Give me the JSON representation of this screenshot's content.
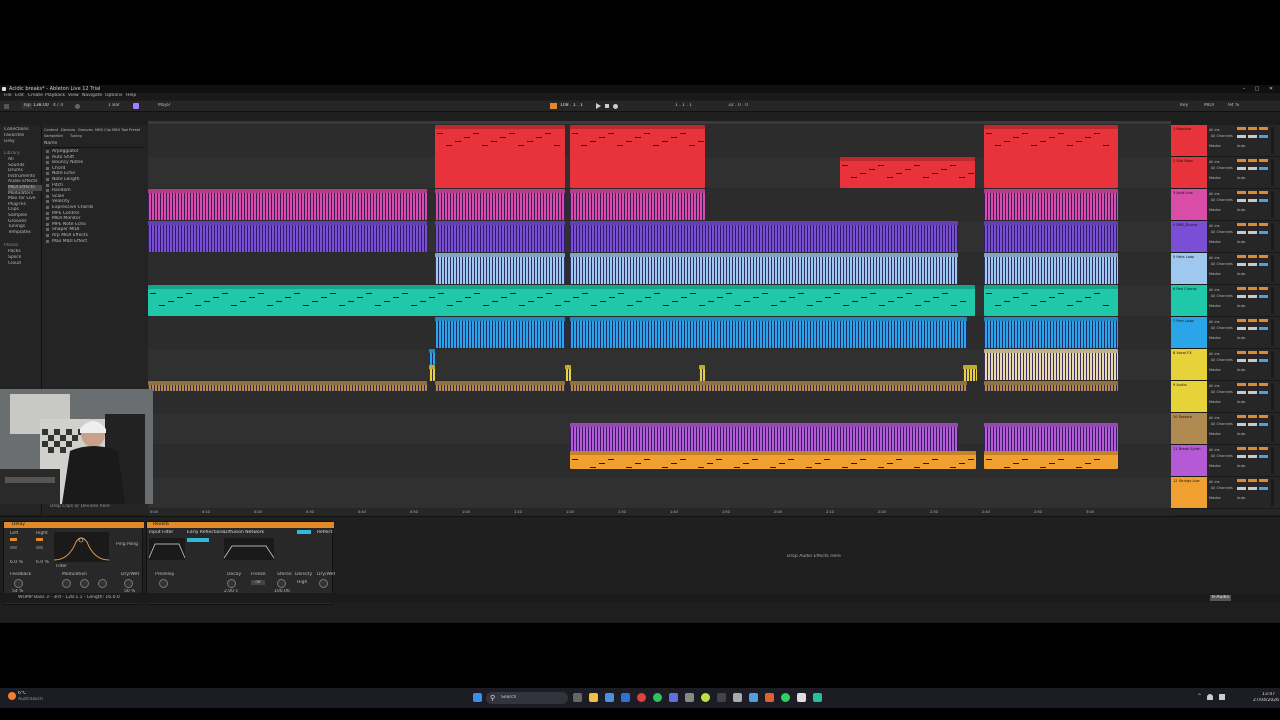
{
  "window": {
    "title": "Acidic breaks* - Ableton Live 12 Trial"
  },
  "menu": [
    "File",
    "Edit",
    "Create",
    "Playback",
    "View",
    "Navigate",
    "Options",
    "Help"
  ],
  "toolbar": {
    "tap": "Tap",
    "tempo": "138.00",
    "sig": "4 / 4",
    "metro": "1 Bar",
    "key": "Major",
    "pos": "108 . 1 . 1",
    "loop_start": "1 . 1 . 1",
    "loop_len": "32 . 0 . 0",
    "cpu": "94 %",
    "key_label": "Key",
    "midi_label": "MIDI"
  },
  "browser": {
    "tabs": [
      "Content",
      "Devices",
      "Grooves",
      "MIDI Clip",
      "MIDI Tool",
      "Preset"
    ],
    "subtabs": [
      "Sample",
      "Set",
      "Tuning"
    ],
    "collections": [
      "Collections",
      "Favorites",
      "Grey"
    ],
    "library_title": "Library",
    "library": [
      "All",
      "Sounds",
      "Drums",
      "Instruments",
      "Audio Effects",
      "MIDI Effects",
      "Modulators",
      "Max for Live",
      "Plug-Ins",
      "Clips",
      "Samples",
      "Grooves",
      "Tunings",
      "Templates"
    ],
    "places_title": "Places",
    "places": [
      "Packs",
      "Splice",
      "Cloud"
    ],
    "header": "Name",
    "items": [
      "Arpeggiator",
      "Auto Shift",
      "Bouncy Notes",
      "Chord",
      "Note Echo",
      "Note Length",
      "Pitch",
      "Random",
      "Scale",
      "Velocity",
      "Expressive Chords",
      "MPE Control",
      "MIDI Monitor",
      "MPE Note Echo",
      "Shaper MIDI",
      "Arp MIDI Effects",
      "Max MIDI Effect"
    ],
    "drop_hint": "Drop Clips or Devices here"
  },
  "ruler": {
    "bars": [
      "1",
      "5",
      "9",
      "13",
      "17",
      "21",
      "25",
      "29",
      "33",
      "37",
      "41",
      "45",
      "49",
      "53",
      "57",
      "61",
      "65",
      "69",
      "73",
      "77",
      "81",
      "85",
      "89",
      "93",
      "97",
      "101",
      "105",
      "109",
      "113",
      "117",
      "121",
      "125"
    ],
    "times": [
      "0:00",
      "0:10",
      "0:20",
      "0:30",
      "0:40",
      "0:50",
      "1:00",
      "1:10",
      "1:20",
      "1:30",
      "1:40",
      "1:50",
      "2:00",
      "2:10",
      "2:20",
      "2:30",
      "2:40",
      "2:50",
      "3:00"
    ]
  },
  "tracks": [
    {
      "name": "1 Bassline",
      "color": "#e8323c"
    },
    {
      "name": "2 Sub Bass",
      "color": "#e8323c"
    },
    {
      "name": "3 Acid Line",
      "color": "#d94ca8"
    },
    {
      "name": "4 BRK_Drums",
      "color": "#7a4fd6"
    },
    {
      "name": "5 Hats Loop",
      "color": "#9fc8ee"
    },
    {
      "name": "6 Pad Chords",
      "color": "#1ec8a8"
    },
    {
      "name": "7 Perc Loop",
      "color": "#2aa6e8"
    },
    {
      "name": "8 Vocal FX",
      "color": "#e8d23a"
    },
    {
      "name": "9 Audio",
      "color": "#e8d23a"
    },
    {
      "name": "10 Texture",
      "color": "#b08a50"
    },
    {
      "name": "11 Break Synth",
      "color": "#b45ad6"
    },
    {
      "name": "12 Strings Low",
      "color": "#f0a030"
    }
  ],
  "mixer": {
    "in_label": "All Ins",
    "ch_label": "All Channels",
    "mon_label": "Auto",
    "out_label": "Master"
  },
  "detail": {
    "device1": "Delay",
    "device2": "Reverb",
    "input_filter": "Input Filter",
    "early": "Early Reflections",
    "diffusion": "Diffusion Network",
    "reflect": "Reflect",
    "drywet": "Dry/Wet",
    "feedback": "Feedback",
    "filter": "Filter",
    "modulation": "Modulation",
    "predelay": "Predelay",
    "decay": "Decay",
    "size": "Size",
    "stereo": "Stereo",
    "freeze": "Freeze",
    "density": "Density",
    "drop_hint": "Drop Audio Effects Here",
    "left": "Left",
    "right": "Right",
    "sync": "Sync",
    "ping_pong": "Ping Pong",
    "pct_left": "6.0 %",
    "pct_right": "6.0 %",
    "feedback_val": "54 %",
    "drywet_val": "50 %",
    "time_val": "1.00 kHz",
    "decay_val": "2.00 s",
    "size_val": "100.00",
    "freeze_val": "Off",
    "density_val": "High"
  },
  "statusbar": {
    "text": "WOMP Bass 3 - 3rd - 128.1.1 - Length: 16.0.0",
    "track_label": "6-Audio"
  },
  "taskbar": {
    "weather_temp": "6°C",
    "weather_desc": "Australisch",
    "search": "Search",
    "time": "13:47",
    "date": "27/04/2026"
  },
  "colors": {
    "red": "#e8323c",
    "pink": "#d94ca8",
    "purple": "#7a4fd6",
    "lightblue": "#9fc8ee",
    "teal": "#1ec8a8",
    "blue": "#2aa6e8",
    "yellow": "#e8d23a",
    "tan": "#b08a50",
    "violet": "#b45ad6",
    "orange": "#f0a030",
    "accent": "#e08a2a"
  }
}
